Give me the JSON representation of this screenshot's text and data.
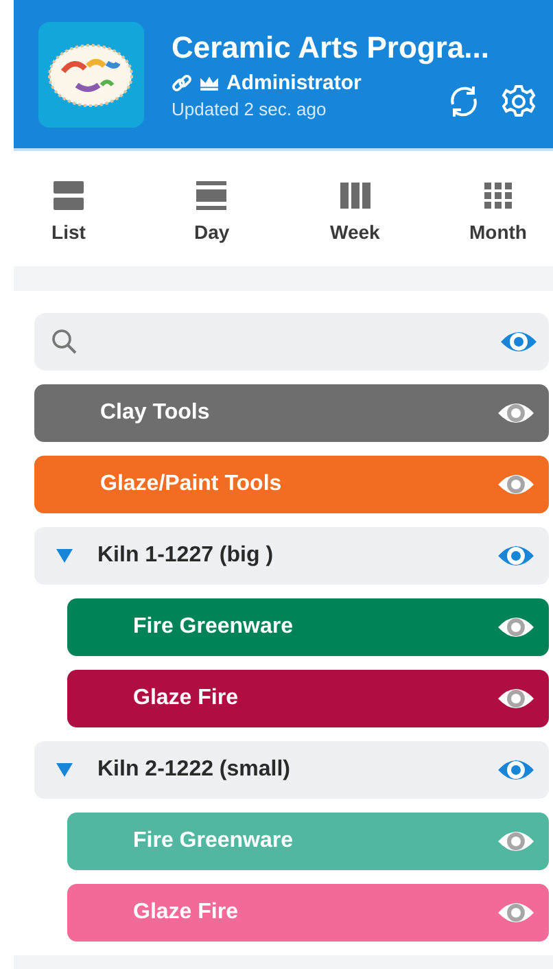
{
  "header": {
    "title": "Ceramic Arts Progra...",
    "role": "Administrator",
    "updated": "Updated 2 sec. ago"
  },
  "views": [
    {
      "label": "List",
      "kind": "list",
      "selected": false
    },
    {
      "label": "Day",
      "kind": "day",
      "selected": false
    },
    {
      "label": "Week",
      "kind": "week",
      "selected": false
    },
    {
      "label": "Month",
      "kind": "month",
      "selected": false
    }
  ],
  "search": {
    "visible": true
  },
  "calendars": [
    {
      "kind": "calendar",
      "name": "Clay Tools",
      "color": "#6e6e6e",
      "visible": true
    },
    {
      "kind": "calendar",
      "name": "Glaze/Paint Tools",
      "color": "#f26d21",
      "visible": true
    },
    {
      "kind": "group",
      "name": "Kiln 1-1227 (big )",
      "expanded": true,
      "visible": true,
      "children": [
        {
          "kind": "calendar",
          "name": "Fire Greenware",
          "color": "#008356",
          "visible": true
        },
        {
          "kind": "calendar",
          "name": "Glaze Fire",
          "color": "#b00d43",
          "visible": true
        }
      ]
    },
    {
      "kind": "group",
      "name": "Kiln 2-1222 (small)",
      "expanded": true,
      "visible": true,
      "children": [
        {
          "kind": "calendar",
          "name": "Fire Greenware",
          "color": "#51b7a0",
          "visible": true
        },
        {
          "kind": "calendar",
          "name": "Glaze Fire",
          "color": "#f26a98",
          "visible": true
        }
      ]
    }
  ]
}
